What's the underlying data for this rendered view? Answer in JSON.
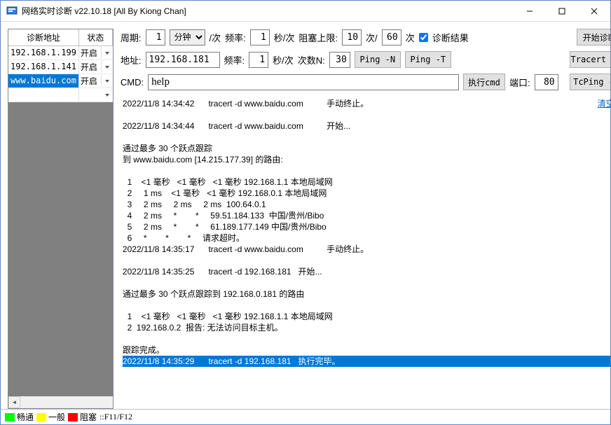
{
  "window": {
    "title": "网络实时诊断 v22.10.18 [All By Kiong Chan]"
  },
  "left_grid": {
    "col_addr": "诊断地址",
    "col_state": "状态",
    "rows": [
      {
        "addr": "192.168.1.199",
        "state": "开启"
      },
      {
        "addr": "192.168.1.141",
        "state": "开启"
      },
      {
        "addr": "www.baidu.com",
        "state": "开启"
      }
    ]
  },
  "controls": {
    "period_lbl": "周期:",
    "period_val": "1",
    "unit_opt": "分钟",
    "per_time": "/次",
    "rate_lbl": "频率:",
    "rate_val": "1",
    "rate_unit": "秒/次",
    "block_lbl": "阻塞上限:",
    "block_a": "10",
    "block_mid": "次/",
    "block_b": "60",
    "block_end": "次",
    "diag_result": "诊断结果",
    "start_diag": "开始诊断",
    "addr_lbl": "地址:",
    "addr_val": "192.168.181",
    "rate2_lbl": "频率:",
    "rate2_val": "1",
    "rate2_unit": "秒/次",
    "count_lbl": "次数N:",
    "count_val": "30",
    "ping_n": "Ping -N",
    "ping_t": "Ping -T",
    "tracert_d": "Tracert -D",
    "cmd_lbl": "CMD:",
    "cmd_val": "help",
    "exec_cmd": "执行cmd",
    "port_lbl": "端口:",
    "port_val": "80",
    "tcping_n": "TcPing -N"
  },
  "console": {
    "clear": "清空×",
    "pre": "2022/11/8 14:34:42      tracert -d www.baidu.com          手动终止。\n\n2022/11/8 14:34:44      tracert -d www.baidu.com          开始...\n\n通过最多 30 个跃点跟踪\n到 www.baidu.com [14.215.177.39] 的路由:\n\n  1    <1 毫秒   <1 毫秒   <1 毫秒 192.168.1.1 本地局域网\n  2     1 ms    <1 毫秒   <1 毫秒 192.168.0.1 本地局域网\n  3     2 ms     2 ms     2 ms  100.64.0.1\n  4     2 ms     *        *     59.51.184.133  中国/贵州/Bibo\n  5     2 ms     *        *     61.189.177.149 中国/贵州/Bibo\n  6     *        *        *     请求超时。\n2022/11/8 14:35:17      tracert -d www.baidu.com          手动终止。\n\n2022/11/8 14:35:25      tracert -d 192.168.181   开始...\n\n通过最多 30 个跃点跟踪到 192.168.0.181 的路由\n\n  1    <1 毫秒   <1 毫秒   <1 毫秒 192.168.1.1 本地局域网\n  2  192.168.0.2  报告: 无法访问目标主机。\n\n跟踪完成。\n",
    "selected": "2022/11/8 14:35:29      tracert -d 192.168.181   执行完毕。"
  },
  "statusbar": {
    "ok": "畅通",
    "mid": "一般",
    "bad": "阻塞",
    "keys": "::F11/F12"
  }
}
